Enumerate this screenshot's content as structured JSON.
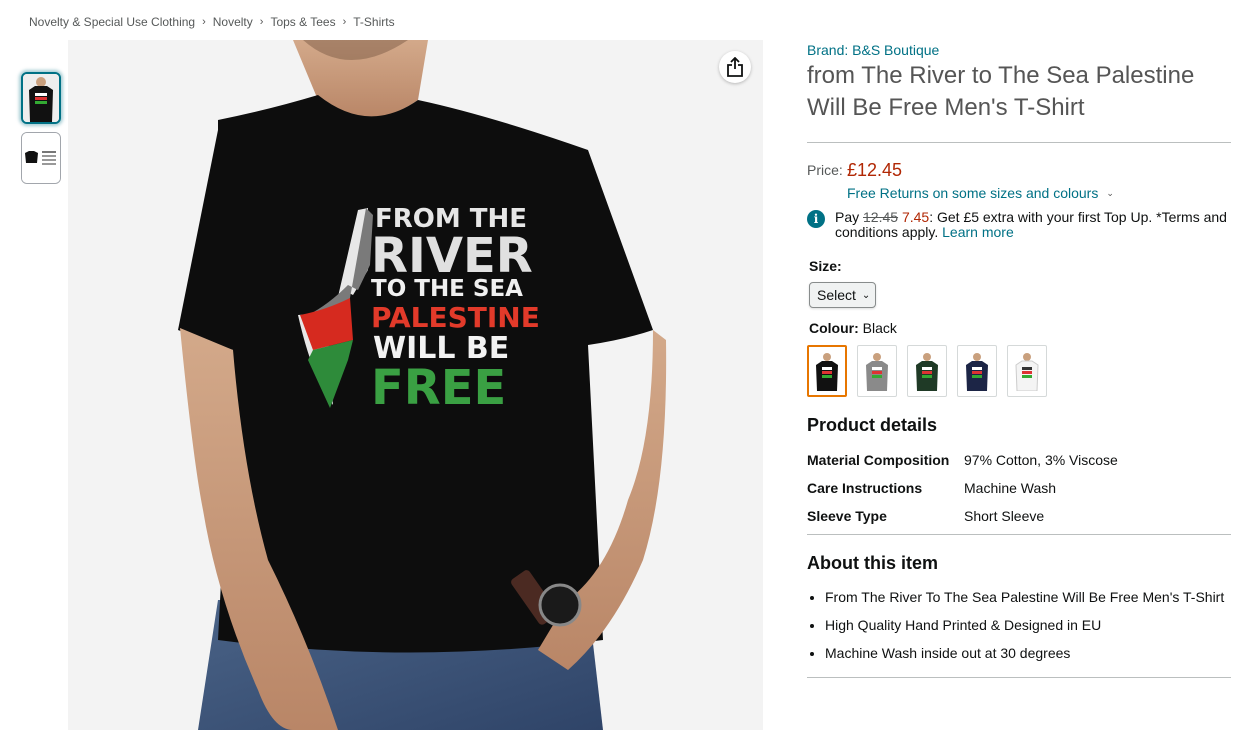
{
  "breadcrumb": [
    "Novelty & Special Use Clothing",
    "Novelty",
    "Tops & Tees",
    "T-Shirts"
  ],
  "product": {
    "brand": "Brand: B&S Boutique",
    "title": "from The River to The Sea Palestine Will Be Free Men's T-Shirt",
    "price_label": "Price:",
    "price": "£12.45",
    "returns": "Free Returns on some sizes and colours",
    "promo": {
      "pay": "Pay",
      "old": "12.45",
      "new": "7.45",
      "text": ": Get £5 extra with your first Top Up. *Terms and conditions apply.",
      "link": "Learn more"
    },
    "size_label": "Size:",
    "size_value": "Select",
    "colour_label": "Colour:",
    "colour_value": "Black",
    "swatch_colors": [
      "#111111",
      "#8a8a8a",
      "#1f3a26",
      "#1c2546",
      "#f4f4f4"
    ]
  },
  "shirt_print": {
    "line1": "FROM THE",
    "line2": "RIVER",
    "line3": "TO THE SEA",
    "line4": "PALESTINE",
    "line5": "WILL BE",
    "line6": "FREE"
  },
  "product_details": {
    "heading": "Product details",
    "rows": [
      {
        "key": "Material Composition",
        "value": "97% Cotton, 3% Viscose"
      },
      {
        "key": "Care Instructions",
        "value": "Machine Wash"
      },
      {
        "key": "Sleeve Type",
        "value": "Short Sleeve"
      }
    ]
  },
  "about": {
    "heading": "About this item",
    "bullets": [
      "From The River To The Sea Palestine Will Be Free Men's T-Shirt",
      "High Quality Hand Printed & Designed in EU",
      "Machine Wash inside out at 30 degrees"
    ]
  },
  "icons": {
    "share": "share-icon",
    "info": "info-icon",
    "chevron": "chevron-down-icon"
  }
}
